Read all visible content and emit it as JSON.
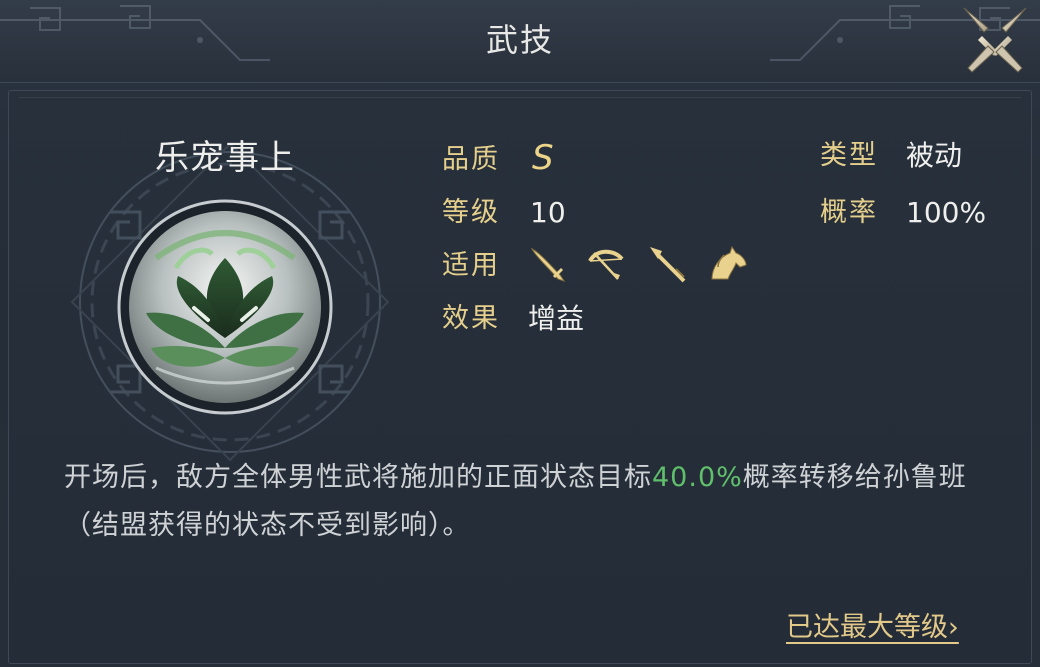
{
  "header": {
    "title": "武技",
    "close_icon": "crossed-blades-close-icon"
  },
  "skill": {
    "name": "乐宠事上",
    "icon": "green-lotus-orb-icon",
    "fields": {
      "quality_label": "品质",
      "quality_value": "S",
      "level_label": "等级",
      "level_value": "10",
      "applies_label": "适用",
      "applies_icons": [
        "sword-icon",
        "bow-icon",
        "spear-icon",
        "horse-icon"
      ],
      "effect_label": "效果",
      "effect_value": "增益",
      "type_label": "类型",
      "type_value": "被动",
      "chance_label": "概率",
      "chance_value": "100%"
    },
    "description": {
      "before": "开场后，敌方全体男性武将施加的正面状态目标",
      "highlight": "40.0%",
      "after": "概率转移给孙鲁班（结盟获得的状态不受到影响）。"
    }
  },
  "footer": {
    "max_level_text": "已达最大等级",
    "chevron": "›"
  },
  "colors": {
    "label_gold": "#e5cf8c",
    "highlight_green": "#5fbf6a",
    "background": "#252d38"
  }
}
